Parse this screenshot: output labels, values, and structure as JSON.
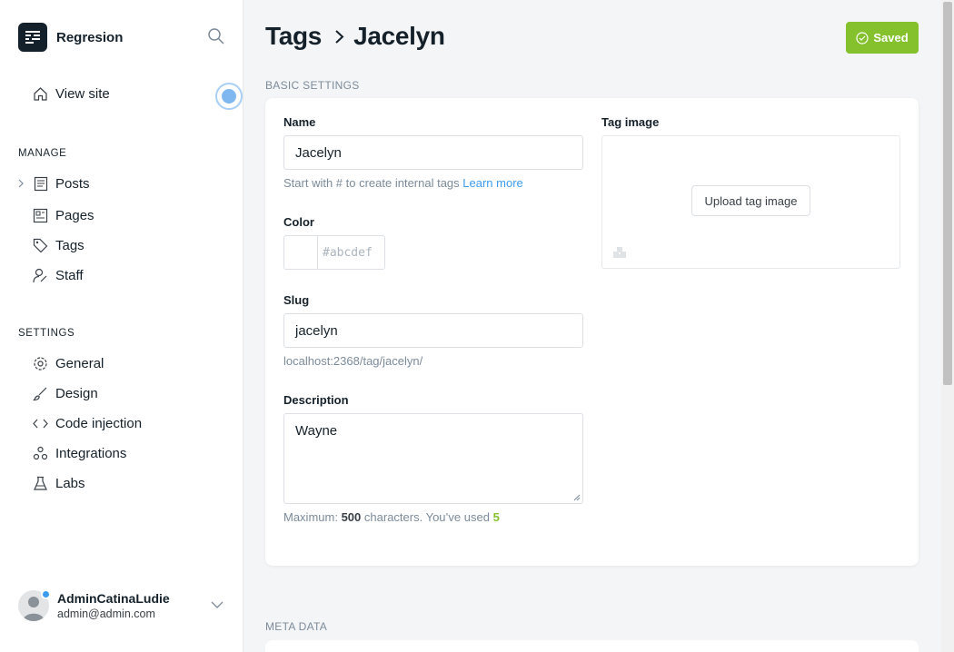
{
  "brand": {
    "name": "Regresion"
  },
  "sidebar": {
    "view_site": "View site",
    "manage_title": "MANAGE",
    "manage_items": [
      "Posts",
      "Pages",
      "Tags",
      "Staff"
    ],
    "settings_title": "SETTINGS",
    "settings_items": [
      "General",
      "Design",
      "Code injection",
      "Integrations",
      "Labs"
    ]
  },
  "user": {
    "name": "AdminCatinaLudie",
    "email": "admin@admin.com"
  },
  "breadcrumb": {
    "parent": "Tags",
    "current": "Jacelyn"
  },
  "status_button": "Saved",
  "basic_settings_title": "BASIC SETTINGS",
  "meta_data_title": "META DATA",
  "form": {
    "name_label": "Name",
    "name_value": "Jacelyn",
    "name_hint": "Start with # to create internal tags",
    "learn_more": "Learn more",
    "color_label": "Color",
    "color_placeholder": "#abcdef",
    "slug_label": "Slug",
    "slug_value": "jacelyn",
    "slug_url": "localhost:2368/tag/jacelyn/",
    "description_label": "Description",
    "description_value": "Wayne",
    "max_prefix": "Maximum:",
    "max_value": "500",
    "max_suffix": "characters. You’ve used",
    "used_count": "5",
    "tag_image_label": "Tag image",
    "upload_label": "Upload tag image"
  },
  "colors": {
    "accent": "#84c12d",
    "link": "#3e9ced",
    "dark": "#15212a"
  }
}
